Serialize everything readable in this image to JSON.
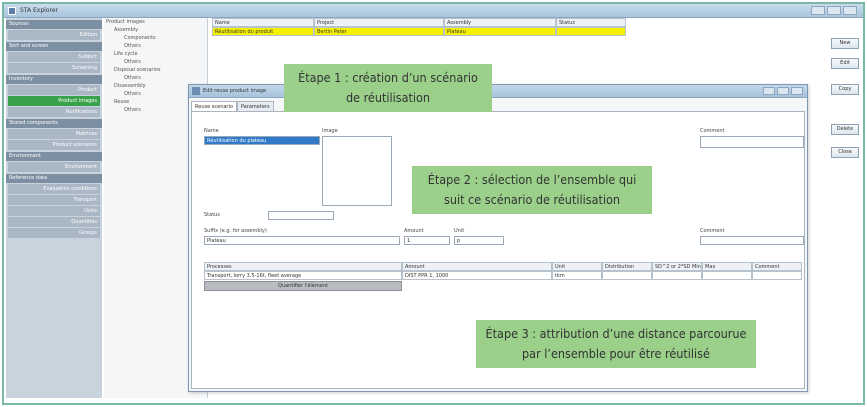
{
  "window": {
    "title": "STA Explorer"
  },
  "nav": {
    "sections": [
      {
        "head": "Sources",
        "items": [
          "Edition"
        ]
      },
      {
        "head": "Sort and screen",
        "items": [
          "Subject",
          "Screening"
        ]
      },
      {
        "head": "Inventory",
        "items": [
          "Product",
          "Product images",
          "Notifications"
        ]
      },
      {
        "head": "Stored components",
        "items": [
          "Matrices",
          "Product scenarios"
        ]
      },
      {
        "head": "Environment",
        "items": [
          "Environment"
        ]
      },
      {
        "head": "Reference data",
        "items": [
          "Evaluation conditions",
          "Transport",
          "Units",
          "Quantities",
          "Groups"
        ]
      }
    ],
    "active": "Product images"
  },
  "tree": {
    "items": [
      "Product images",
      "Assembly",
      "Components",
      "Others",
      "Life cycle",
      "Others",
      "Disposal scenarios",
      "Others",
      "Disassembly",
      "Others",
      "Reuse",
      "Others"
    ]
  },
  "grid": {
    "headers": [
      "Name",
      "Project",
      "Assembly",
      "Status"
    ],
    "selected_row": [
      "Réutilisation du produit",
      "Bertin Peter",
      "Plateau",
      ""
    ]
  },
  "right_buttons": [
    "New",
    "Edit",
    "Copy",
    "Delete",
    "Close"
  ],
  "dialog": {
    "title": "Edit reuse product image",
    "tabs": [
      "Reuse scenario",
      "Parameters"
    ],
    "name_label": "Name",
    "name_value": "Réutilisation du plateau",
    "image_label": "Image",
    "status_label": "Status",
    "suffix_label": "Suffix (e.g. for assembly)",
    "suffix_value": "Plateau",
    "amount_label": "Amount",
    "amount_value": "1",
    "unit_label": "Unit",
    "unit_value": "p",
    "comment_label": "Comment",
    "comment_label_2": "Comment",
    "processes_header": [
      "Processes",
      "Amount",
      "Unit",
      "Distribution",
      "SD^2 or 2*SD Min",
      "Max",
      "Comment"
    ],
    "process_row": [
      "Transport, lorry 3.5-16t, fleet average",
      "DIST PPR 1, 1000",
      "tkm"
    ],
    "process_button": "Quantifier l'élément"
  },
  "callouts": {
    "step1": "Étape 1 : création d’un scénario de réutilisation",
    "step2": "Étape 2 : sélection de l’ensemble qui suit ce scénario de réutilisation",
    "step3": "Étape 3 : attribution d’une distance parcourue par l’ensemble pour être réutilisé"
  },
  "colors": {
    "callout_bg": "#9ad08a",
    "highlight_row": "#f5f000",
    "frame": "#79b9a6",
    "nav_active": "#3aa24a"
  }
}
